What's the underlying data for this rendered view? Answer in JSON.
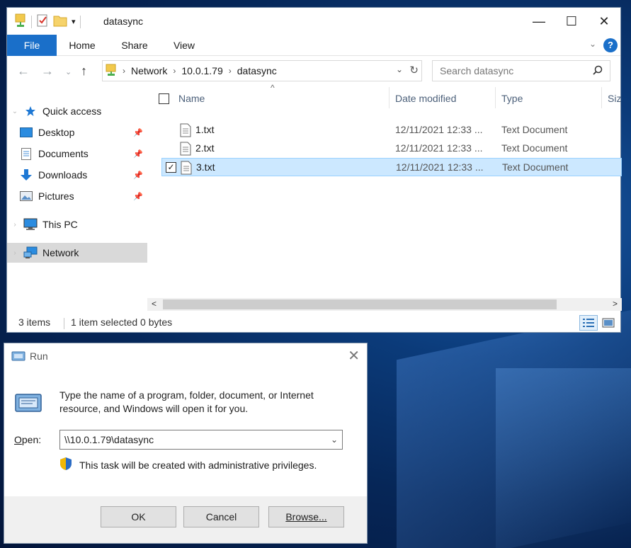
{
  "explorer": {
    "title": "datasync",
    "caption": {
      "minimize": "—",
      "maximize": "☐",
      "close": "✕"
    },
    "ribbon": {
      "tabs": [
        {
          "label": "File"
        },
        {
          "label": "Home"
        },
        {
          "label": "Share"
        },
        {
          "label": "View"
        }
      ],
      "expand_glyph": "⌄",
      "help_glyph": "?"
    },
    "nav": {
      "back_glyph": "←",
      "forward_glyph": "→",
      "recent_glyph": "⌄",
      "up_glyph": "↑",
      "breadcrumb": [
        "Network",
        "10.0.1.79",
        "datasync"
      ],
      "crumb_sep": "›",
      "address_drop_glyph": "⌄",
      "refresh_glyph": "↻",
      "search_placeholder": "Search datasync"
    },
    "navpane": {
      "items": [
        {
          "label": "Quick access",
          "icon": "star-icon"
        },
        {
          "label": "Desktop",
          "icon": "desktop-folder-icon",
          "pinned": true
        },
        {
          "label": "Documents",
          "icon": "documents-icon",
          "pinned": true
        },
        {
          "label": "Downloads",
          "icon": "download-arrow-icon",
          "pinned": true
        },
        {
          "label": "Pictures",
          "icon": "pictures-icon",
          "pinned": true
        },
        {
          "label": "This PC",
          "icon": "monitor-icon"
        },
        {
          "label": "Network",
          "icon": "network-icon",
          "selected": true
        }
      ],
      "pin_glyph": "📌"
    },
    "columns": [
      "Name",
      "Date modified",
      "Type",
      "Size"
    ],
    "files": [
      {
        "name": "1.txt",
        "date": "12/11/2021 12:33 ...",
        "type": "Text Document",
        "selected": false
      },
      {
        "name": "2.txt",
        "date": "12/11/2021 12:33 ...",
        "type": "Text Document",
        "selected": false
      },
      {
        "name": "3.txt",
        "date": "12/11/2021 12:33 ...",
        "type": "Text Document",
        "selected": true
      }
    ],
    "status": {
      "count": "3 items",
      "selection": "1 item selected  0 bytes"
    },
    "scroll": {
      "left_glyph": "<",
      "right_glyph": ">"
    }
  },
  "run": {
    "title": "Run",
    "close_glyph": "✕",
    "description": "Type the name of a program, folder, document, or Internet resource, and Windows will open it for you.",
    "open_label_pre": "",
    "open_label_u": "O",
    "open_label_post": "pen:",
    "open_value": "\\\\10.0.1.79\\datasync",
    "drop_glyph": "⌄",
    "admin_note": "This task will be created with administrative privileges.",
    "buttons": {
      "ok": "OK",
      "cancel": "Cancel",
      "browse": "Browse..."
    }
  },
  "colors": {
    "accent": "#1a6fc9",
    "selection": "#cce8ff",
    "selection_border": "#99d1ff"
  }
}
